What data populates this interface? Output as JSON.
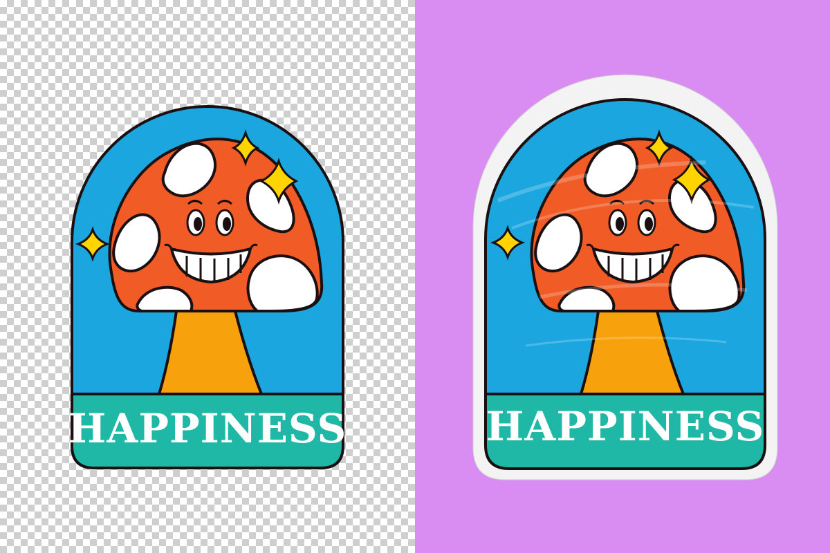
{
  "canvas": {
    "background_right": "#d98cf1"
  },
  "sticker": {
    "label": "HAPPINESS",
    "colors": {
      "sky": "#1ba6df",
      "banner": "#1fb8a6",
      "outline": "#1a1012",
      "cap": "#f05b26",
      "spots": "#ffffff",
      "stem": "#f7a10c",
      "sparkle": "#ffd400",
      "text": "#ffffff"
    }
  },
  "views": [
    {
      "name": "transparent-preview"
    },
    {
      "name": "poster-mockup"
    }
  ]
}
